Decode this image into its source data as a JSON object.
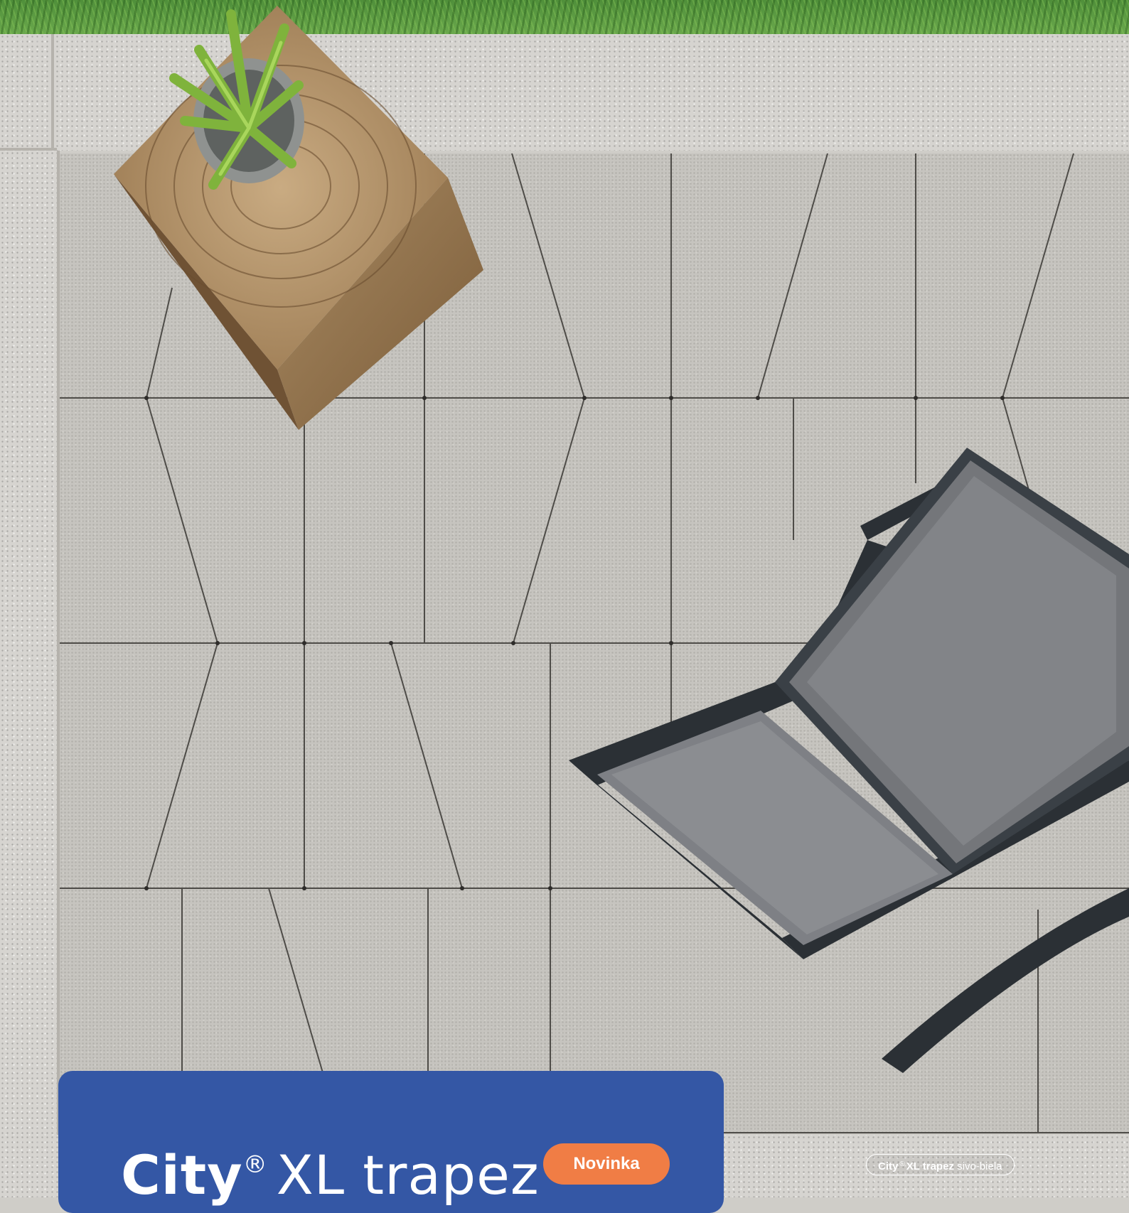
{
  "product": {
    "brand": "City",
    "registered_mark": "®",
    "name": "XL trapez",
    "badge": "Novinka"
  },
  "caption": {
    "brand": "City",
    "registered_mark": "®",
    "name": "XL trapez",
    "color": "sivo-biela"
  },
  "colors": {
    "card_blue": "#3457a5",
    "badge_orange": "#f07d45",
    "paving_grey": "#c6c4bf",
    "granite": "#d6d4d0"
  }
}
